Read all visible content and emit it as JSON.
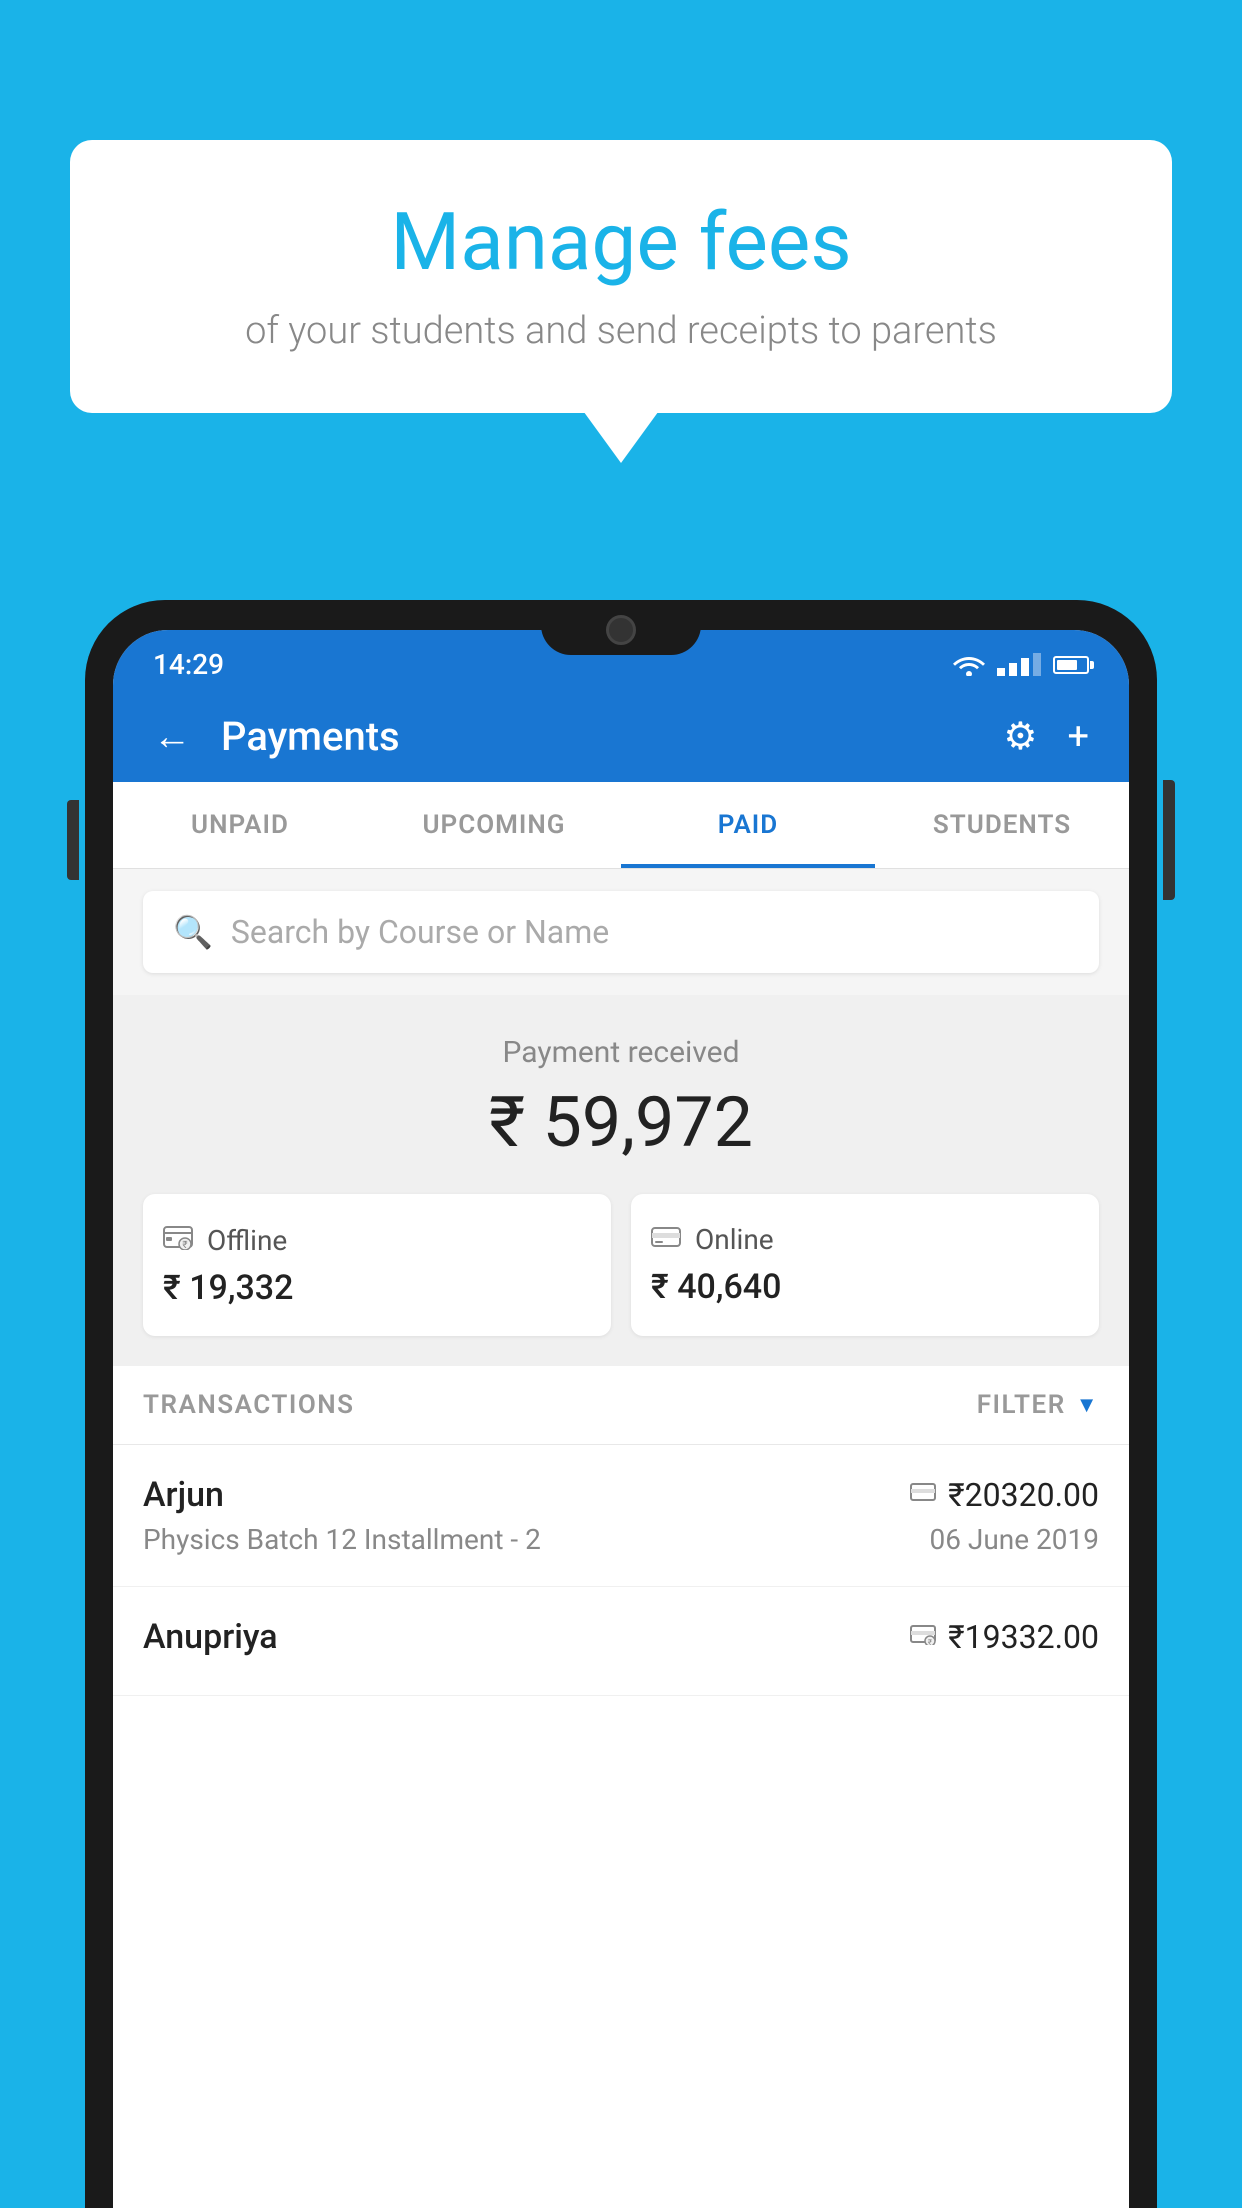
{
  "background": {
    "color": "#1ab3e8"
  },
  "speech_bubble": {
    "title": "Manage fees",
    "subtitle": "of your students and send receipts to parents"
  },
  "status_bar": {
    "time": "14:29"
  },
  "app_header": {
    "title": "Payments",
    "back_label": "←",
    "settings_label": "⚙",
    "add_label": "+"
  },
  "tabs": [
    {
      "label": "UNPAID",
      "active": false
    },
    {
      "label": "UPCOMING",
      "active": false
    },
    {
      "label": "PAID",
      "active": true
    },
    {
      "label": "STUDENTS",
      "active": false
    }
  ],
  "search": {
    "placeholder": "Search by Course or Name"
  },
  "payment_summary": {
    "label": "Payment received",
    "total": "₹ 59,972",
    "offline": {
      "label": "Offline",
      "amount": "₹ 19,332"
    },
    "online": {
      "label": "Online",
      "amount": "₹ 40,640"
    }
  },
  "transactions": {
    "header": "TRANSACTIONS",
    "filter": "FILTER",
    "items": [
      {
        "name": "Arjun",
        "course": "Physics Batch 12 Installment - 2",
        "amount": "₹20320.00",
        "date": "06 June 2019",
        "payment_type": "card"
      },
      {
        "name": "Anupriya",
        "course": "",
        "amount": "₹19332.00",
        "date": "",
        "payment_type": "offline"
      }
    ]
  },
  "icons": {
    "search": "🔍",
    "back": "←",
    "gear": "⚙",
    "plus": "+",
    "offline": "₹",
    "online": "💳",
    "filter_triangle": "▼",
    "card_payment": "💳",
    "offline_payment": "₹"
  }
}
